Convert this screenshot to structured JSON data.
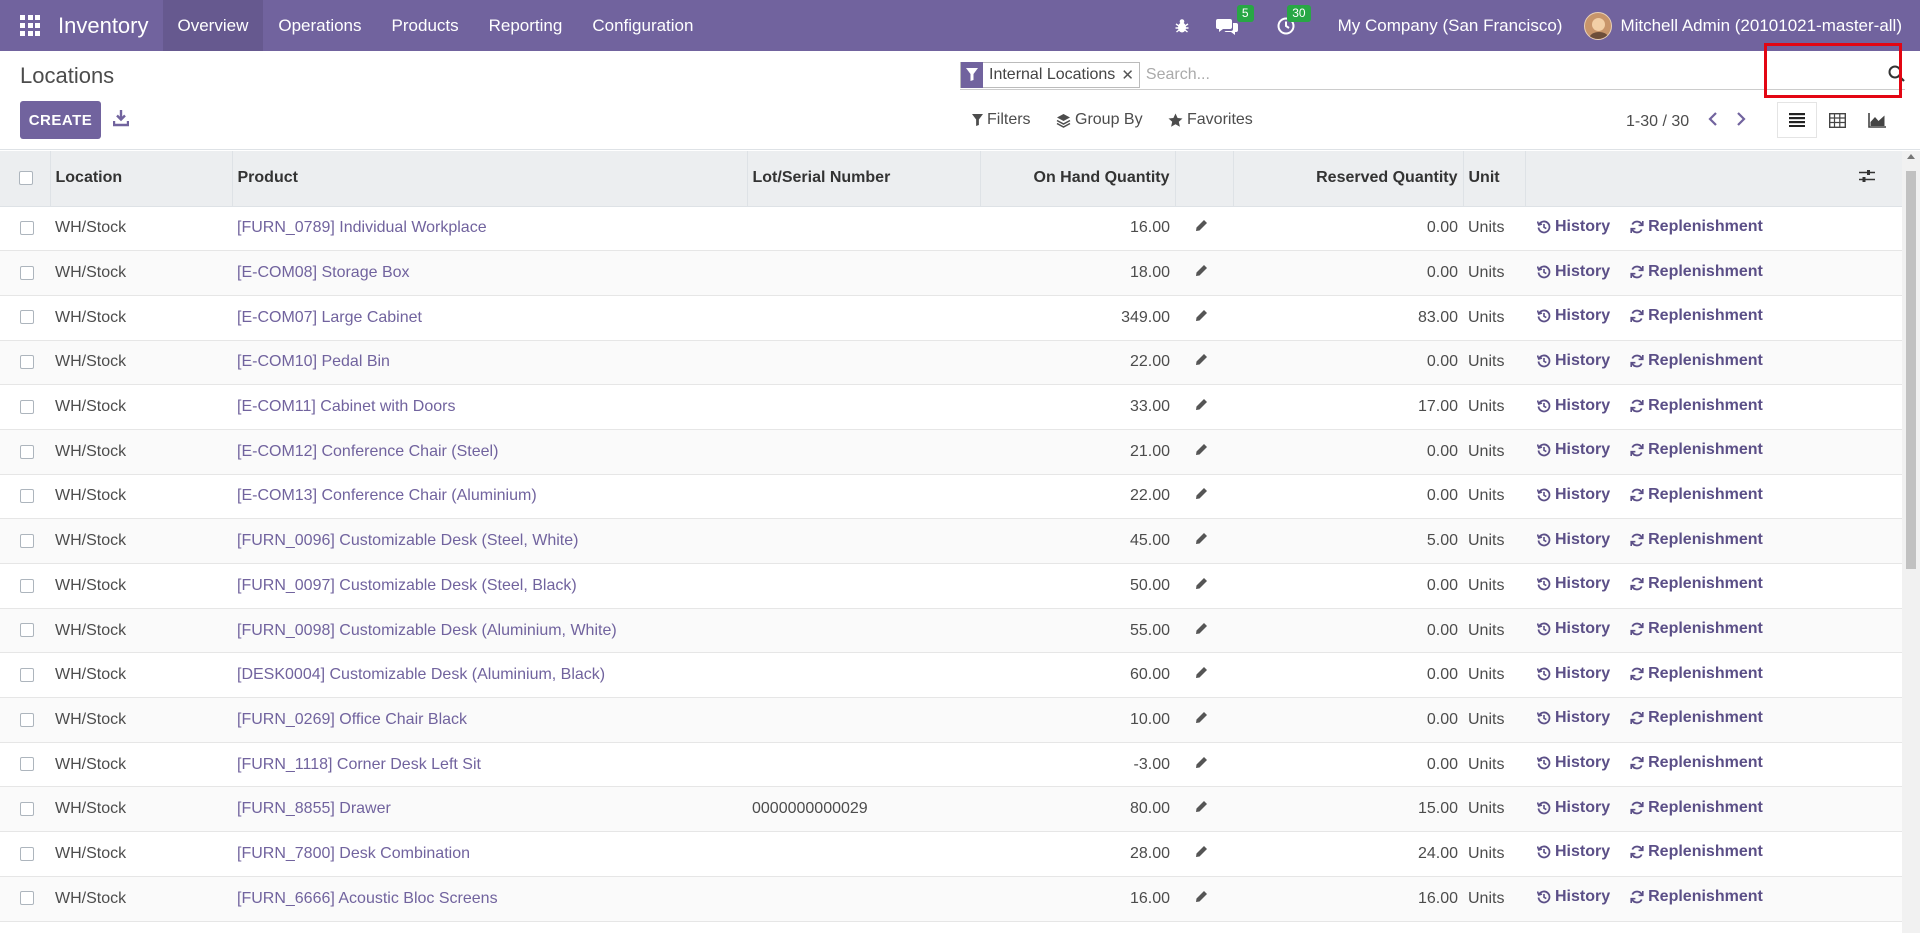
{
  "topbar": {
    "app_title": "Inventory",
    "menu": [
      "Overview",
      "Operations",
      "Products",
      "Reporting",
      "Configuration"
    ],
    "active_menu": "Overview",
    "messages_badge": "5",
    "activities_badge": "30",
    "company": "My Company (San Francisco)",
    "user": "Mitchell Admin (20101021-master-all)"
  },
  "control": {
    "breadcrumb": "Locations",
    "create_label": "CREATE",
    "facet_value": "Internal Locations",
    "search_placeholder": "Search...",
    "filters_label": "Filters",
    "groupby_label": "Group By",
    "favorites_label": "Favorites",
    "pager": "1-30 / 30"
  },
  "table": {
    "headers": [
      "Location",
      "Product",
      "Lot/Serial Number",
      "On Hand Quantity",
      "Reserved Quantity",
      "Unit"
    ],
    "history_label": "History",
    "replenishment_label": "Replenishment",
    "rows": [
      {
        "location": "WH/Stock",
        "product": "[FURN_0789] Individual Workplace",
        "lot": "",
        "on_hand": "16.00",
        "reserved": "0.00",
        "unit": "Units"
      },
      {
        "location": "WH/Stock",
        "product": "[E-COM08] Storage Box",
        "lot": "",
        "on_hand": "18.00",
        "reserved": "0.00",
        "unit": "Units"
      },
      {
        "location": "WH/Stock",
        "product": "[E-COM07] Large Cabinet",
        "lot": "",
        "on_hand": "349.00",
        "reserved": "83.00",
        "unit": "Units"
      },
      {
        "location": "WH/Stock",
        "product": "[E-COM10] Pedal Bin",
        "lot": "",
        "on_hand": "22.00",
        "reserved": "0.00",
        "unit": "Units"
      },
      {
        "location": "WH/Stock",
        "product": "[E-COM11] Cabinet with Doors",
        "lot": "",
        "on_hand": "33.00",
        "reserved": "17.00",
        "unit": "Units"
      },
      {
        "location": "WH/Stock",
        "product": "[E-COM12] Conference Chair (Steel)",
        "lot": "",
        "on_hand": "21.00",
        "reserved": "0.00",
        "unit": "Units"
      },
      {
        "location": "WH/Stock",
        "product": "[E-COM13] Conference Chair (Aluminium)",
        "lot": "",
        "on_hand": "22.00",
        "reserved": "0.00",
        "unit": "Units"
      },
      {
        "location": "WH/Stock",
        "product": "[FURN_0096] Customizable Desk (Steel, White)",
        "lot": "",
        "on_hand": "45.00",
        "reserved": "5.00",
        "unit": "Units"
      },
      {
        "location": "WH/Stock",
        "product": "[FURN_0097] Customizable Desk (Steel, Black)",
        "lot": "",
        "on_hand": "50.00",
        "reserved": "0.00",
        "unit": "Units"
      },
      {
        "location": "WH/Stock",
        "product": "[FURN_0098] Customizable Desk (Aluminium, White)",
        "lot": "",
        "on_hand": "55.00",
        "reserved": "0.00",
        "unit": "Units"
      },
      {
        "location": "WH/Stock",
        "product": "[DESK0004] Customizable Desk (Aluminium, Black)",
        "lot": "",
        "on_hand": "60.00",
        "reserved": "0.00",
        "unit": "Units"
      },
      {
        "location": "WH/Stock",
        "product": "[FURN_0269] Office Chair Black",
        "lot": "",
        "on_hand": "10.00",
        "reserved": "0.00",
        "unit": "Units"
      },
      {
        "location": "WH/Stock",
        "product": "[FURN_1118] Corner Desk Left Sit",
        "lot": "",
        "on_hand": "-3.00",
        "reserved": "0.00",
        "unit": "Units"
      },
      {
        "location": "WH/Stock",
        "product": "[FURN_8855] Drawer",
        "lot": "0000000000029",
        "on_hand": "80.00",
        "reserved": "15.00",
        "unit": "Units"
      },
      {
        "location": "WH/Stock",
        "product": "[FURN_7800] Desk Combination",
        "lot": "",
        "on_hand": "28.00",
        "reserved": "24.00",
        "unit": "Units"
      },
      {
        "location": "WH/Stock",
        "product": "[FURN_6666] Acoustic Bloc Screens",
        "lot": "",
        "on_hand": "16.00",
        "reserved": "16.00",
        "unit": "Units"
      }
    ]
  }
}
